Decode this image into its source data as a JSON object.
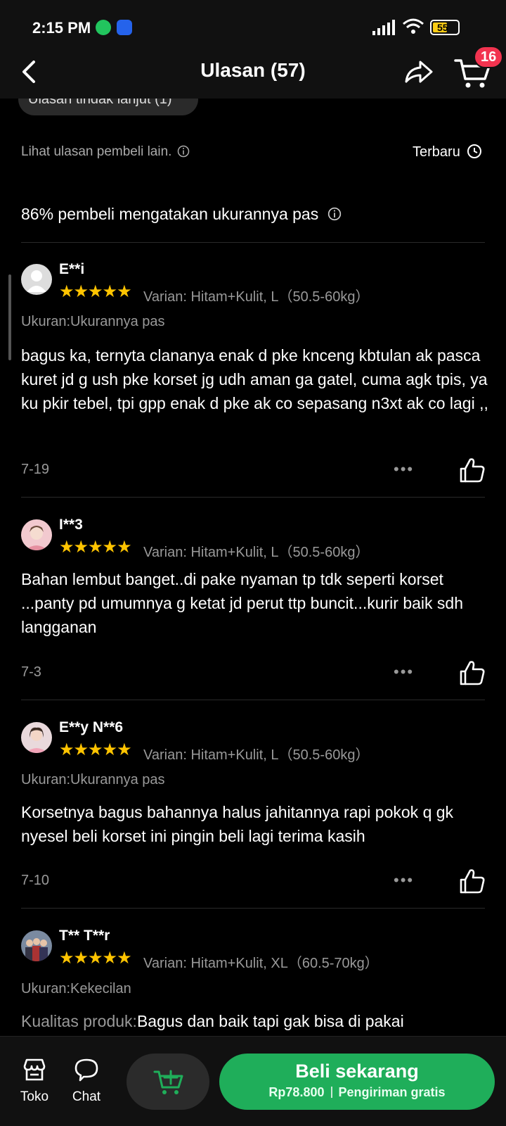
{
  "status_bar": {
    "time": "2:15 PM",
    "battery": "55"
  },
  "header": {
    "title": "Ulasan (57)",
    "cart_count": "16"
  },
  "filter_chip": "Ulasan tindak lanjut (1)",
  "info": {
    "text": "Lihat ulasan pembeli lain.",
    "sort": "Terbaru"
  },
  "fit_summary": "86% pembeli mengatakan ukurannya pas",
  "reviews": [
    {
      "name": "E**i",
      "rating": 5,
      "variant": "Varian: Hitam+Kulit, L（50.5-60kg）",
      "size": "Ukuran:Ukurannya pas",
      "text": "bagus ka, ternyta clananya enak d pke knceng  kbtulan ak pasca kuret jd g ush pke korset jg udh aman  ga gatel,  cuma agk tpis, ya ku pkir tebel, tpi gpp enak d pke ak co sepasang n3xt ak co lagi ,,",
      "date": "7-19"
    },
    {
      "name": "I**3",
      "rating": 5,
      "variant": "Varian: Hitam+Kulit, L（50.5-60kg）",
      "size": "",
      "text": "Bahan lembut banget..di pake nyaman tp tdk seperti korset ...panty pd umumnya g ketat jd perut ttp buncit...kurir baik sdh langganan",
      "date": "7-3"
    },
    {
      "name": "E**y N**6",
      "rating": 5,
      "variant": "Varian: Hitam+Kulit, L（50.5-60kg）",
      "size": "Ukuran:Ukurannya pas",
      "text": "Korsetnya bagus bahannya halus jahitannya rapi pokok q gk nyesel beli korset ini pingin beli lagi terima kasih",
      "date": "7-10"
    },
    {
      "name": "T** T**r",
      "rating": 5,
      "variant": "Varian: Hitam+Kulit, XL（60.5-70kg）",
      "size": "Ukuran:Kekecilan",
      "text_label": "Kualitas produk:",
      "text": "Bagus dan baik tapi gak bisa di pakai"
    }
  ],
  "stars_glyph": "★★★★★",
  "more_glyph": "•••",
  "bottom_bar": {
    "shop_label": "Toko",
    "chat_label": "Chat",
    "buy_label": "Beli sekarang",
    "price": "Rp78.800",
    "shipping": "Pengiriman gratis"
  },
  "colors": {
    "accent": "#1fae5a",
    "star": "#ffc400",
    "badge": "#f2334f"
  }
}
